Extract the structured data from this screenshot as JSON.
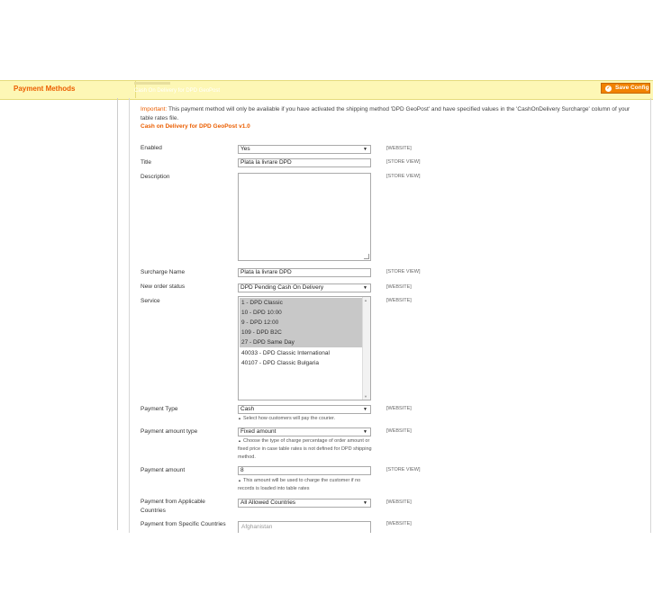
{
  "header": {
    "section_title": "Payment Methods",
    "group_title": "Cash On Delivery for DPD GeoPost",
    "save_label": "Save Config"
  },
  "note": {
    "important_label": "Important:",
    "text": "This payment method will only be available if you have activated the shipping method 'DPD GeoPost' and have specified values in the 'CashOnDelivery Surcharge' column of your table rates file.",
    "version": "Cash on Delivery for DPD GeoPost v1.0"
  },
  "fields": {
    "enabled": {
      "label": "Enabled",
      "value": "Yes",
      "scope": "[WEBSITE]"
    },
    "title": {
      "label": "Title",
      "value": "Plata la livrare DPD",
      "scope": "[STORE VIEW]"
    },
    "description": {
      "label": "Description",
      "value": "",
      "scope": "[STORE VIEW]"
    },
    "surcharge_name": {
      "label": "Surcharge Name",
      "value": "Plata la livrare DPD",
      "scope": "[STORE VIEW]"
    },
    "new_order_status": {
      "label": "New order status",
      "value": "DPD Pending Cash On Delivery",
      "scope": "[WEBSITE]"
    },
    "service": {
      "label": "Service",
      "scope": "[WEBSITE]",
      "options": [
        {
          "label": "1 - DPD Classic",
          "selected": true
        },
        {
          "label": "10 - DPD 10:00",
          "selected": true
        },
        {
          "label": "9 - DPD 12:00",
          "selected": true
        },
        {
          "label": "109 - DPD B2C",
          "selected": true
        },
        {
          "label": "27 - DPD Same Day",
          "selected": true
        },
        {
          "label": "40033 - DPD Classic International",
          "selected": false
        },
        {
          "label": "40107 - DPD Classic Bulgaria",
          "selected": false
        }
      ]
    },
    "payment_type": {
      "label": "Payment Type",
      "value": "Cash",
      "scope": "[WEBSITE]",
      "hint": "Select how customers will pay the courier."
    },
    "payment_amount_type": {
      "label": "Payment amount type",
      "value": "Fixed amount",
      "scope": "[WEBSITE]",
      "hint": "Choose the type of charge percentage of order amount or fixed price in case table rates is not defined for DPD shipping method."
    },
    "payment_amount": {
      "label": "Payment amount",
      "value": "8",
      "scope": "[STORE VIEW]",
      "hint": "This amount will be used to charge the customer if no records is loaded into table rates"
    },
    "payment_from_applicable": {
      "label": "Payment from Applicable Countries",
      "value": "All Allowed Countries",
      "scope": "[WEBSITE]"
    },
    "payment_from_specific": {
      "label": "Payment from Specific Countries",
      "first_option": "Afghanistan",
      "scope": "[WEBSITE]"
    }
  },
  "colors": {
    "accent": "#eb5e00",
    "header_bg": "#fdf7b5",
    "button": "#f18200",
    "selected_option": "#c8c8c8"
  }
}
